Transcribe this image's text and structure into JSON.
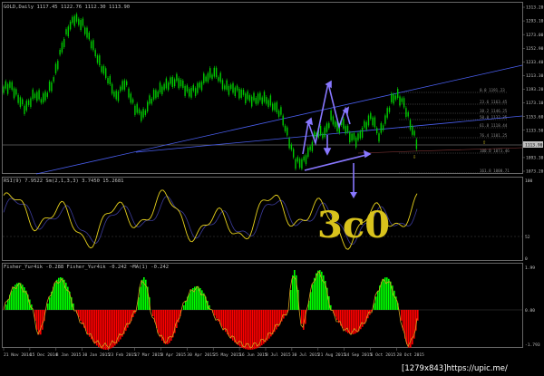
{
  "window": {
    "symbol": "GOLD,Daily",
    "quote": {
      "open": "1117.45",
      "high": "1122.76",
      "low": "1112.30",
      "close": "1113.90"
    },
    "price_tag": "1113.90"
  },
  "price_axis": [
    "1313.20",
    "1293.10",
    "1273.00",
    "1252.90",
    "1233.40",
    "1213.30",
    "1193.20",
    "1173.10",
    "1153.60",
    "1133.50",
    "1113.40",
    "1093.30",
    "1073.20"
  ],
  "fib_levels": [
    {
      "label": "0.0",
      "value": "1191.23"
    },
    {
      "label": "23.6",
      "value": "1163.45"
    },
    {
      "label": "38.2",
      "value": "1146.25"
    },
    {
      "label": "50.0",
      "value": "1132.35"
    },
    {
      "label": "61.8",
      "value": "1118.44"
    },
    {
      "label": "76.4",
      "value": "1101.25"
    },
    {
      "label": "100.0",
      "value": "1073.46"
    },
    {
      "label": "161.8",
      "value": "1000.71"
    }
  ],
  "rsi": {
    "title": "RSI(9) 7.9522  Sm(2,1,3,3) 3.7450 15.2681",
    "axis": [
      "100",
      "52",
      "0"
    ]
  },
  "fisher": {
    "title": "Fisher_Yur4ik -0.288  Fisher_Yur4ik -0.242  ~MA(1) -0.242",
    "axis": [
      "1.99",
      "0.00",
      "-1.793"
    ]
  },
  "annotation": "3c0",
  "date_axis": [
    "21 Nov 2014",
    "15 Dec 2014",
    "8 Jan 2015",
    "30 Jan 2015",
    "23 Feb 2015",
    "17 Mar 2015",
    "8 Apr 2015",
    "30 Apr 2015",
    "25 May 2015",
    "16 Jun 2015",
    "8 Jul 2015",
    "30 Jul 2015",
    "21 Aug 2015",
    "14 Sep 2015",
    "6 Oct 2015",
    "28 Oct 2015"
  ],
  "watermark": "[1279x843]https://upic.me/",
  "colors": {
    "background": "#000000",
    "bull_candle": "#00cc00",
    "pane_border": "#808080",
    "trend_line": "#4a5ff0",
    "wave_arrow": "#8877ff",
    "rsi_line": "#e8d21c",
    "rsi_signal": "#3c3c9c",
    "hist_positive": "#00ff00",
    "hist_negative": "#ff0000",
    "fisher_line": "#d4a020",
    "handwriting": "#d8c21c"
  }
}
